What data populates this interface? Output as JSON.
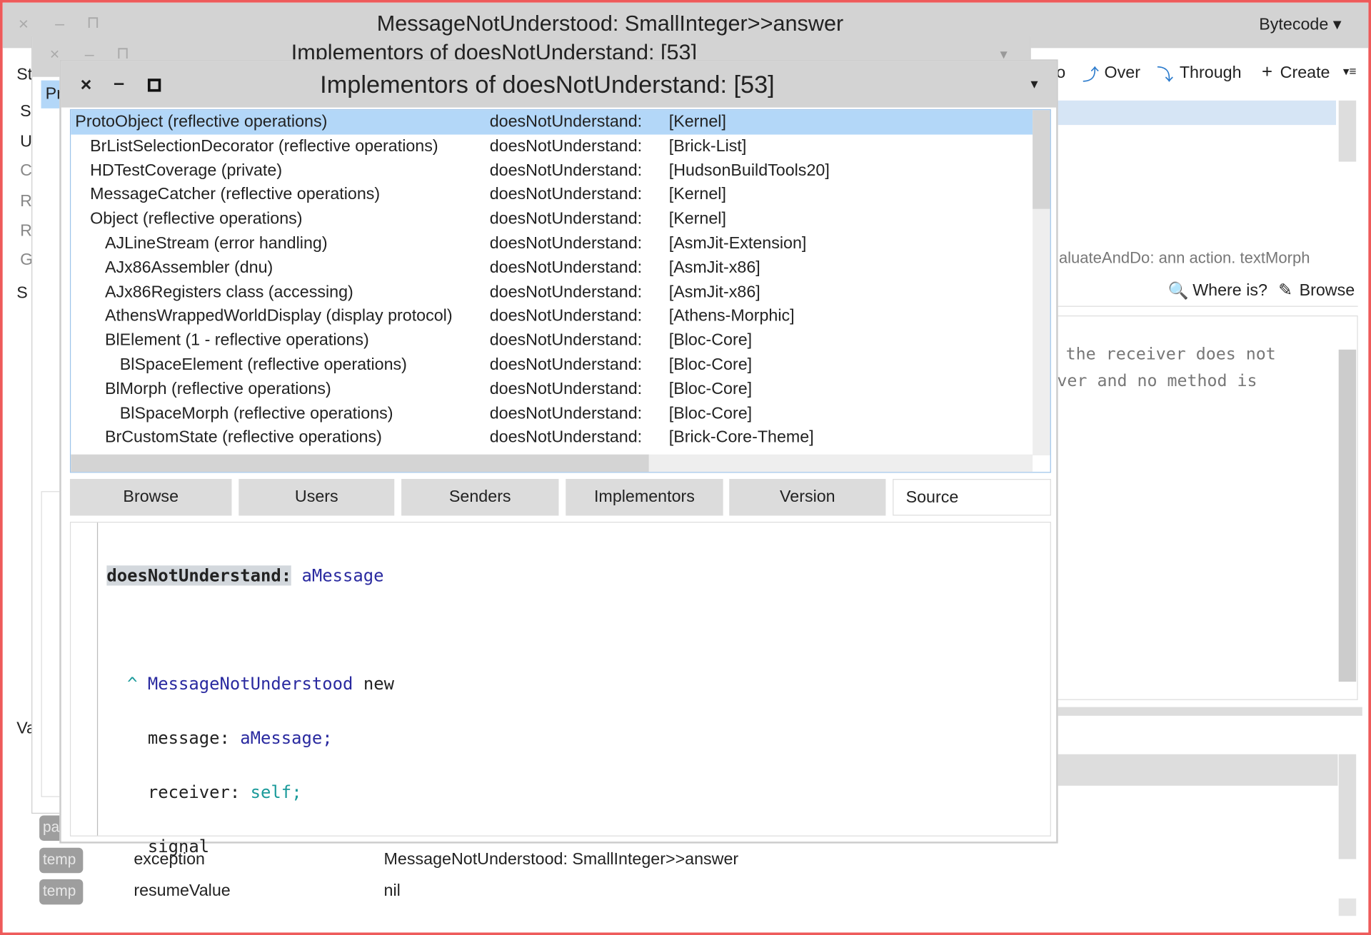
{
  "back_window": {
    "title": "MessageNotUnderstood: SmallInteger>>answer",
    "bytecode_label": "Bytecode",
    "toolbar": {
      "into": "o",
      "over": "Over",
      "through": "Through",
      "create": "Create"
    },
    "left_labels": [
      "St",
      "S",
      "U",
      "C",
      "R",
      "R",
      "G",
      "S",
      "Va"
    ],
    "source_fragment": "aluateAndDo: ann action. textMorph",
    "where_is": "Where is?",
    "browse": "Browse",
    "comment_lines": [
      "the receiver does not",
      "ver and no method is"
    ],
    "variables": [
      {
        "badge": "pa",
        "name": "",
        "value": ""
      },
      {
        "badge": "temp",
        "name": "exception",
        "value": "MessageNotUnderstood: SmallInteger>>answer"
      },
      {
        "badge": "temp",
        "name": "resumeValue",
        "value": "nil"
      }
    ]
  },
  "middle_window": {
    "title": "Implementors of doesNotUnderstand: [53]",
    "tab_label": "Pr"
  },
  "front_window": {
    "title": "Implementors of doesNotUnderstand: [53]",
    "rows": [
      {
        "cls": "ProtoObject (reflective operations)",
        "sel": "doesNotUnderstand:",
        "pkg": "[Kernel]",
        "indent": 0,
        "selected": true
      },
      {
        "cls": "BrListSelectionDecorator (reflective operations)",
        "sel": "doesNotUnderstand:",
        "pkg": "[Brick-List]",
        "indent": 1
      },
      {
        "cls": "HDTestCoverage (private)",
        "sel": "doesNotUnderstand:",
        "pkg": "[HudsonBuildTools20]",
        "indent": 1
      },
      {
        "cls": "MessageCatcher (reflective operations)",
        "sel": "doesNotUnderstand:",
        "pkg": "[Kernel]",
        "indent": 1
      },
      {
        "cls": "Object (reflective operations)",
        "sel": "doesNotUnderstand:",
        "pkg": "[Kernel]",
        "indent": 1
      },
      {
        "cls": "AJLineStream (error handling)",
        "sel": "doesNotUnderstand:",
        "pkg": "[AsmJit-Extension]",
        "indent": 2
      },
      {
        "cls": "AJx86Assembler (dnu)",
        "sel": "doesNotUnderstand:",
        "pkg": "[AsmJit-x86]",
        "indent": 2
      },
      {
        "cls": "AJx86Registers class (accessing)",
        "sel": "doesNotUnderstand:",
        "pkg": "[AsmJit-x86]",
        "indent": 2
      },
      {
        "cls": "AthensWrappedWorldDisplay (display protocol)",
        "sel": "doesNotUnderstand:",
        "pkg": "[Athens-Morphic]",
        "indent": 2
      },
      {
        "cls": "BlElement (1 - reflective operations)",
        "sel": "doesNotUnderstand:",
        "pkg": "[Bloc-Core]",
        "indent": 2
      },
      {
        "cls": "BlSpaceElement (reflective operations)",
        "sel": "doesNotUnderstand:",
        "pkg": "[Bloc-Core]",
        "indent": 3
      },
      {
        "cls": "BlMorph (reflective operations)",
        "sel": "doesNotUnderstand:",
        "pkg": "[Bloc-Core]",
        "indent": 2
      },
      {
        "cls": "BlSpaceMorph (reflective operations)",
        "sel": "doesNotUnderstand:",
        "pkg": "[Bloc-Core]",
        "indent": 3
      },
      {
        "cls": "BrCustomState (reflective operations)",
        "sel": "doesNotUnderstand:",
        "pkg": "[Brick-Core-Theme]",
        "indent": 2
      }
    ],
    "buttons": [
      "Browse",
      "Users",
      "Senders",
      "Implementors",
      "Version",
      "Source"
    ],
    "active_button": "Source",
    "code": {
      "selector": "doesNotUnderstand:",
      "arg": "aMessage",
      "caret": "^",
      "class_name": "MessageNotUnderstood",
      "new": "new",
      "kw1": "message:",
      "v1": "aMessage;",
      "kw2": "receiver:",
      "v2": "self;",
      "signal": "signal"
    }
  },
  "colors": {
    "selection": "#b3d7f8",
    "frame": "#ee5a5a",
    "arg": "#2a2aa0",
    "self": "#1a9a9a"
  }
}
